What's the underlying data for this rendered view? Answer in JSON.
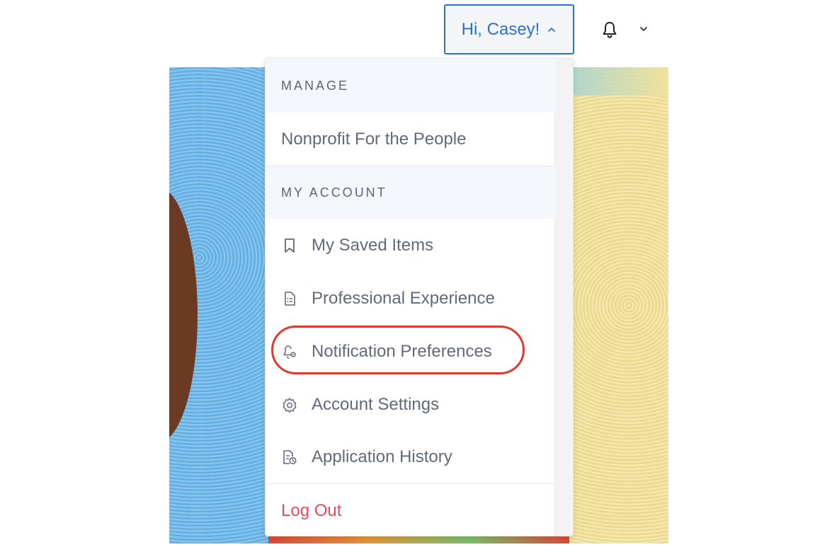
{
  "header": {
    "greeting": "Hi, Casey!",
    "accent_color": "#2b6fd6",
    "icons": [
      "chevron-up-icon",
      "bell-icon",
      "chevron-down-icon"
    ]
  },
  "menu": {
    "manage_section": {
      "title": "MANAGE",
      "items": [
        {
          "label": "Nonprofit For the People"
        }
      ]
    },
    "account_section": {
      "title": "MY ACCOUNT",
      "items": [
        {
          "label": "My Saved Items",
          "icon": "bookmark-icon"
        },
        {
          "label": "Professional Experience",
          "icon": "document-list-icon"
        },
        {
          "label": "Notification Preferences",
          "icon": "bell-settings-icon",
          "highlighted": true
        },
        {
          "label": "Account Settings",
          "icon": "gear-icon"
        },
        {
          "label": "Application History",
          "icon": "document-clock-icon"
        }
      ]
    },
    "logout_label": "Log Out",
    "logout_color": "#e64a5a",
    "highlight_color": "#e03a2e"
  }
}
